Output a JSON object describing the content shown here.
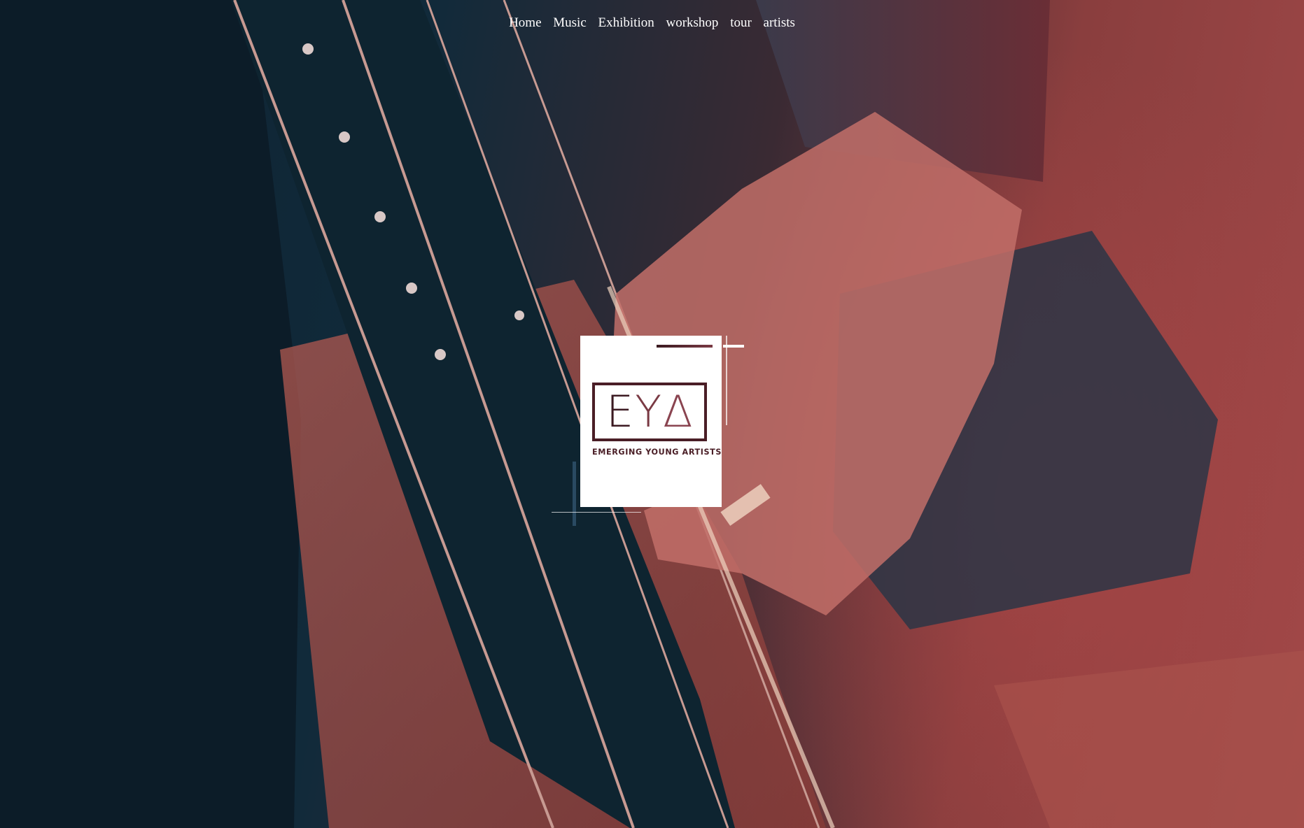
{
  "nav": {
    "items": [
      {
        "label": "Home"
      },
      {
        "label": "Music"
      },
      {
        "label": "Exhibition"
      },
      {
        "label": "workshop"
      },
      {
        "label": "tour"
      },
      {
        "label": "artists"
      }
    ]
  },
  "logo": {
    "letter_e": "E",
    "letter_y": "Y",
    "letter_a": "Δ",
    "subtitle": "EMERGING YOUNG ARTISTS"
  },
  "background": {
    "icon": "cello-hand-photo"
  },
  "colors": {
    "logo_dark": "#4a1e26",
    "logo_light": "#8a4450",
    "nav_text": "#ffffff"
  }
}
